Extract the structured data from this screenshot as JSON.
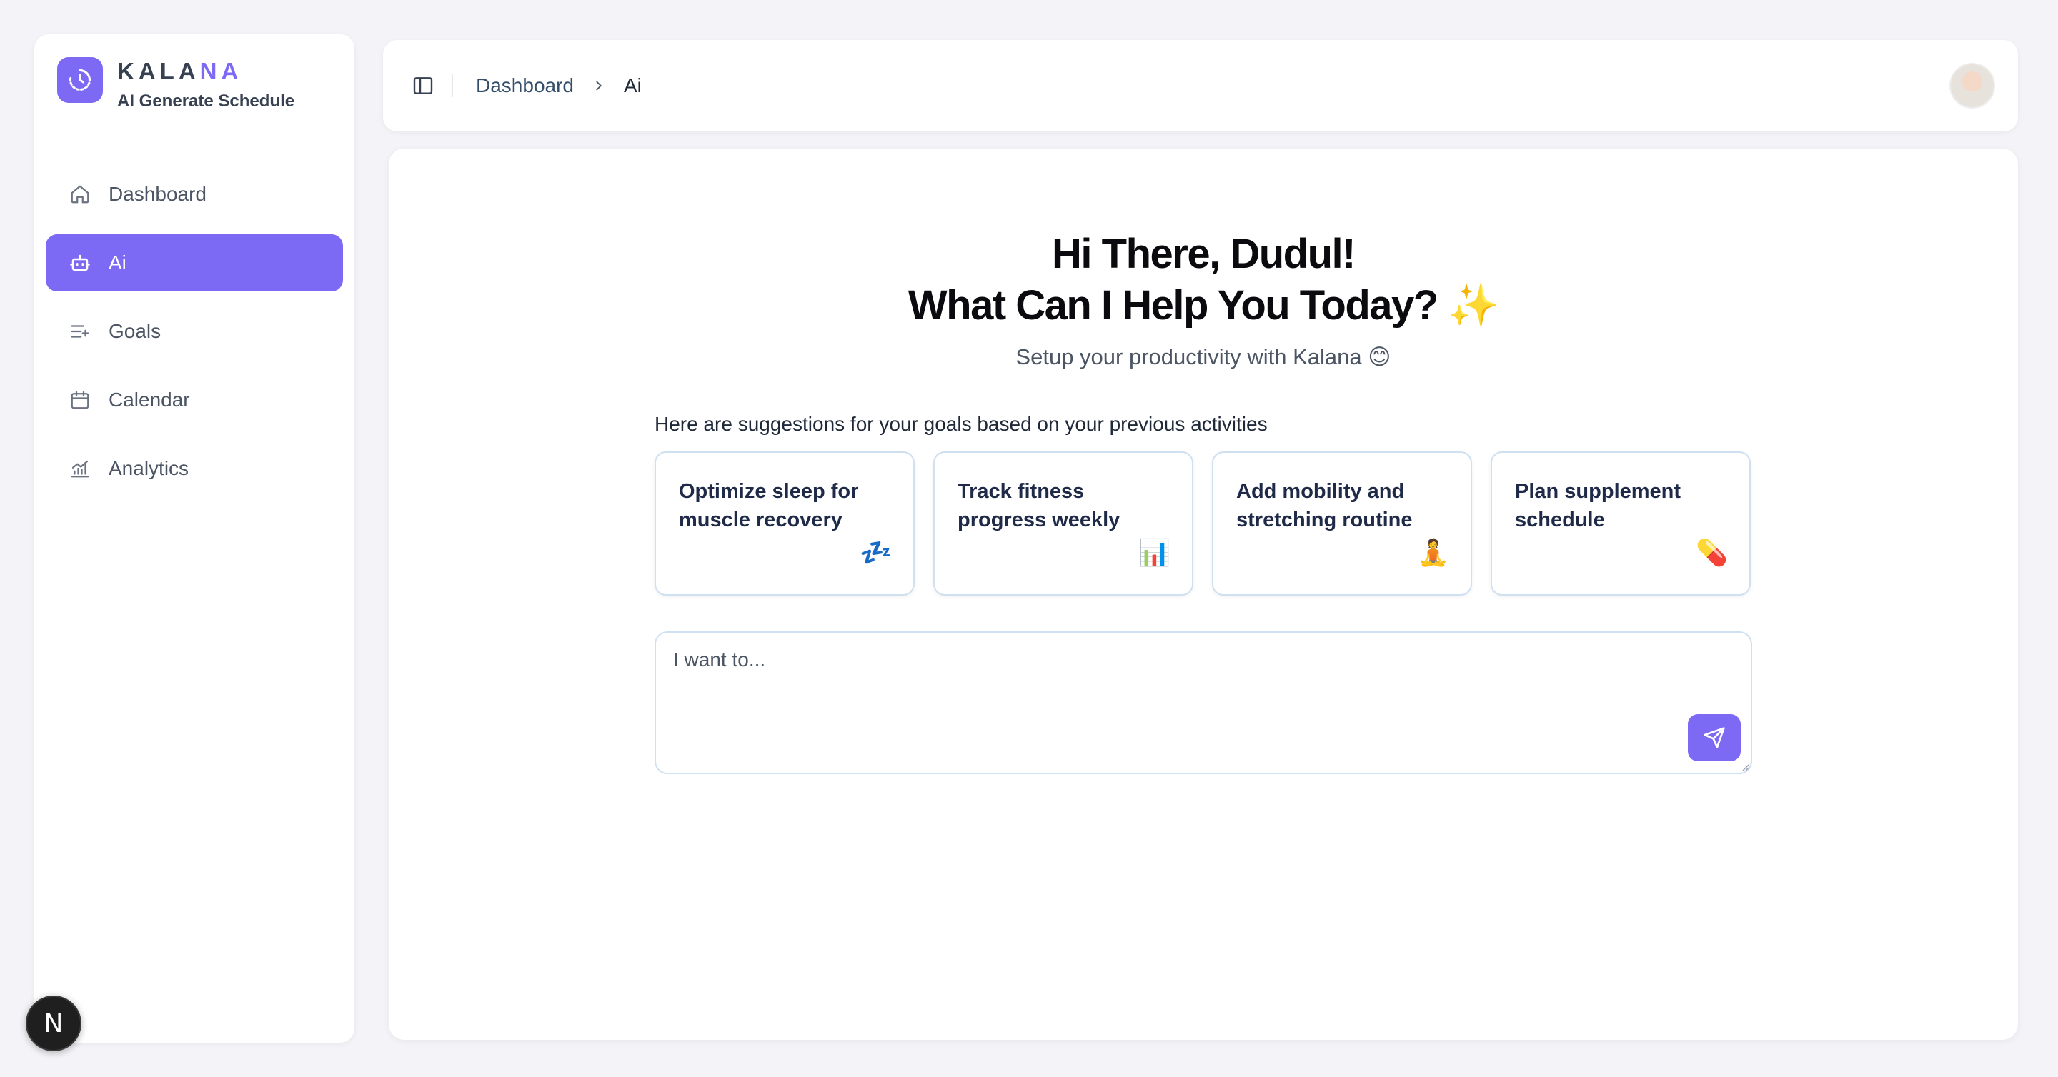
{
  "brand": {
    "name_main": "KALA",
    "name_accent": "NA",
    "subtitle": "AI Generate Schedule",
    "accent_color": "#7c6af5"
  },
  "sidebar": {
    "items": [
      {
        "label": "Dashboard",
        "icon": "home-icon",
        "active": false
      },
      {
        "label": "Ai",
        "icon": "robot-icon",
        "active": true
      },
      {
        "label": "Goals",
        "icon": "list-plus-icon",
        "active": false
      },
      {
        "label": "Calendar",
        "icon": "calendar-icon",
        "active": false
      },
      {
        "label": "Analytics",
        "icon": "chart-icon",
        "active": false
      }
    ]
  },
  "header": {
    "toggle_icon": "sidebar-toggle-icon",
    "breadcrumb": [
      "Dashboard",
      "Ai"
    ],
    "avatar_icon": "user-avatar"
  },
  "main": {
    "greeting_line1": "Hi There, Dudul!",
    "greeting_line2": "What Can I Help You Today? ✨",
    "subtitle": "Setup your productivity with Kalana 😊",
    "suggestions_title": "Here are suggestions for your goals based on your previous activities",
    "suggestions": [
      {
        "text": "Optimize sleep for muscle recovery",
        "emoji": "💤"
      },
      {
        "text": "Track fitness progress weekly",
        "emoji": "📊"
      },
      {
        "text": "Add mobility and stretching routine",
        "emoji": "🧘"
      },
      {
        "text": "Plan supplement schedule",
        "emoji": "💊"
      }
    ],
    "input": {
      "placeholder": "I want to...",
      "value": "",
      "send_icon": "send-icon"
    }
  },
  "dev_badge": {
    "letter": "N"
  }
}
